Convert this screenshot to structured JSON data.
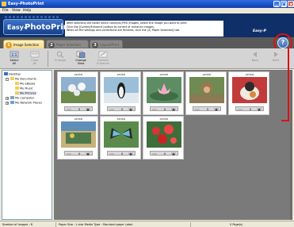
{
  "window": {
    "title": "Easy-PhotoPrint"
  },
  "menu": {
    "items": [
      "File",
      "View",
      "Help"
    ]
  },
  "banner": {
    "logo_prefix": "Easy-",
    "logo_main": "PhotoPrint",
    "instructions": [
      "After selecting the folder which contains JPEG images, select the image you want to print.",
      "Click the [Correct/Enhance] button to correct or enhance images.",
      "When all the settings and corrections are finished, click the (2) Paper Selection] tab."
    ],
    "brand_small": "Easy-P"
  },
  "tabs": [
    {
      "number": "1",
      "label": "Image Selection"
    },
    {
      "number": "2",
      "label": "Paper Selection"
    },
    {
      "number": "3",
      "label": "Layout/Print"
    }
  ],
  "help": {
    "label": "?"
  },
  "toolbar": {
    "select_all": [
      "Select",
      "All"
    ],
    "clear_all": [
      "Clear",
      "All"
    ],
    "enlarge": [
      "Enlarge"
    ],
    "change_view": [
      "Change",
      "View"
    ],
    "correct_enhance": [
      "Correct/",
      "Enhance"
    ],
    "back": [
      "Back"
    ],
    "next": [
      "Next"
    ]
  },
  "tree": {
    "items": [
      "Desktop",
      "My Documents",
      "My eBooks",
      "My Music",
      "My Pictures",
      "My Computer",
      "My Network Places"
    ]
  },
  "thumbnails": [
    {
      "name": "penkai",
      "count": "0"
    },
    {
      "name": "penkai",
      "count": "0"
    },
    {
      "name": "penkai",
      "count": "0"
    },
    {
      "name": "penkai",
      "count": "0"
    },
    {
      "name": "penkai",
      "count": "0"
    },
    {
      "name": "penkai",
      "count": "0"
    },
    {
      "name": "penkai",
      "count": "0"
    },
    {
      "name": "penkai",
      "count": "0"
    }
  ],
  "status": {
    "images": "Number of images : 8",
    "paper": "Paper Size : L size  Media Type : Standard paper Label",
    "pages": "0 Page(s)"
  },
  "colors": {
    "banner": "#0f2f69",
    "accent_tab": "#e49a1f",
    "callout": "#dd1111"
  }
}
